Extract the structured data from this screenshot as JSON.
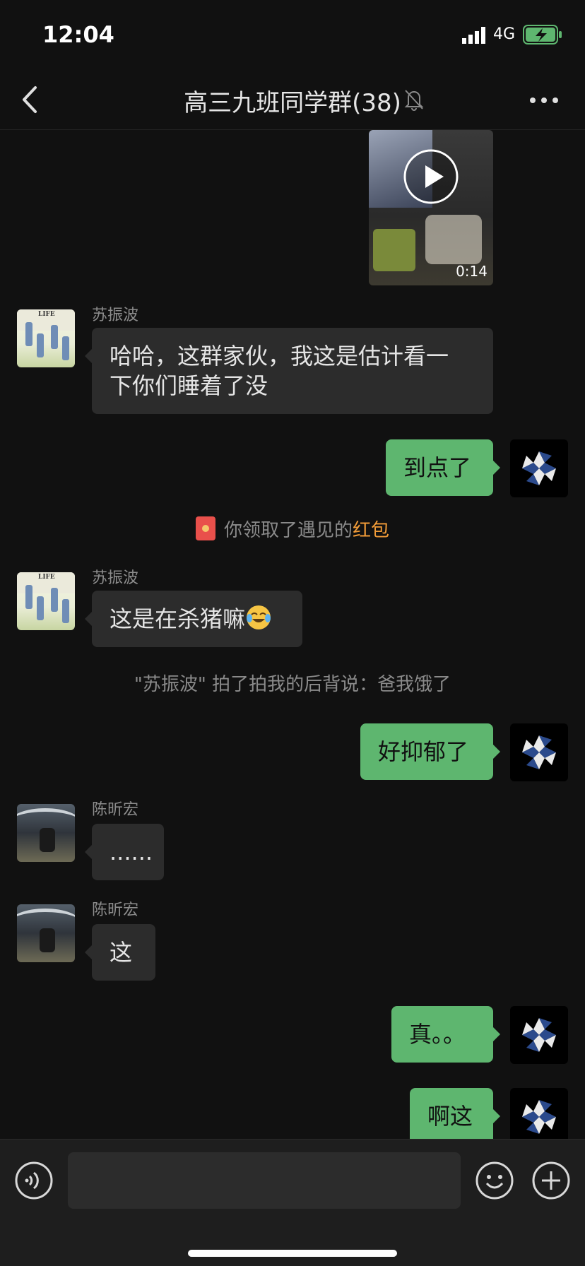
{
  "status": {
    "time": "12:04",
    "network": "4G"
  },
  "header": {
    "title": "高三九班同学群(38)"
  },
  "video": {
    "duration": "0:14"
  },
  "messages": {
    "m1": {
      "sender": "苏振波",
      "text1": "哈哈，这群家伙，我这是估计看一",
      "text2": "下你们睡着了没"
    },
    "m2": {
      "text": "到点了"
    },
    "sys1": {
      "prefix": "你领取了遇见的",
      "highlight": "红包"
    },
    "m3": {
      "sender": "苏振波",
      "text": "这是在杀猪嘛"
    },
    "sys2": {
      "text": "\"苏振波\" 拍了拍我的后背说：爸我饿了"
    },
    "m4": {
      "text": "好抑郁了"
    },
    "m5": {
      "sender": "陈昕宏",
      "text": "......"
    },
    "m6": {
      "sender": "陈昕宏",
      "text": "这"
    },
    "m7": {
      "text": "真。。"
    },
    "m8": {
      "text": "啊这"
    }
  },
  "input": {
    "value": "",
    "placeholder": ""
  },
  "colors": {
    "accent_green": "#5eb66f",
    "highlight_orange": "#f29c38",
    "background": "#111111"
  },
  "icons": [
    "back-icon",
    "mute-bell-icon",
    "more-icon",
    "play-icon",
    "voice-icon",
    "emoji-icon",
    "plus-icon",
    "umbrella-avatar-icon",
    "red-envelope-icon"
  ]
}
